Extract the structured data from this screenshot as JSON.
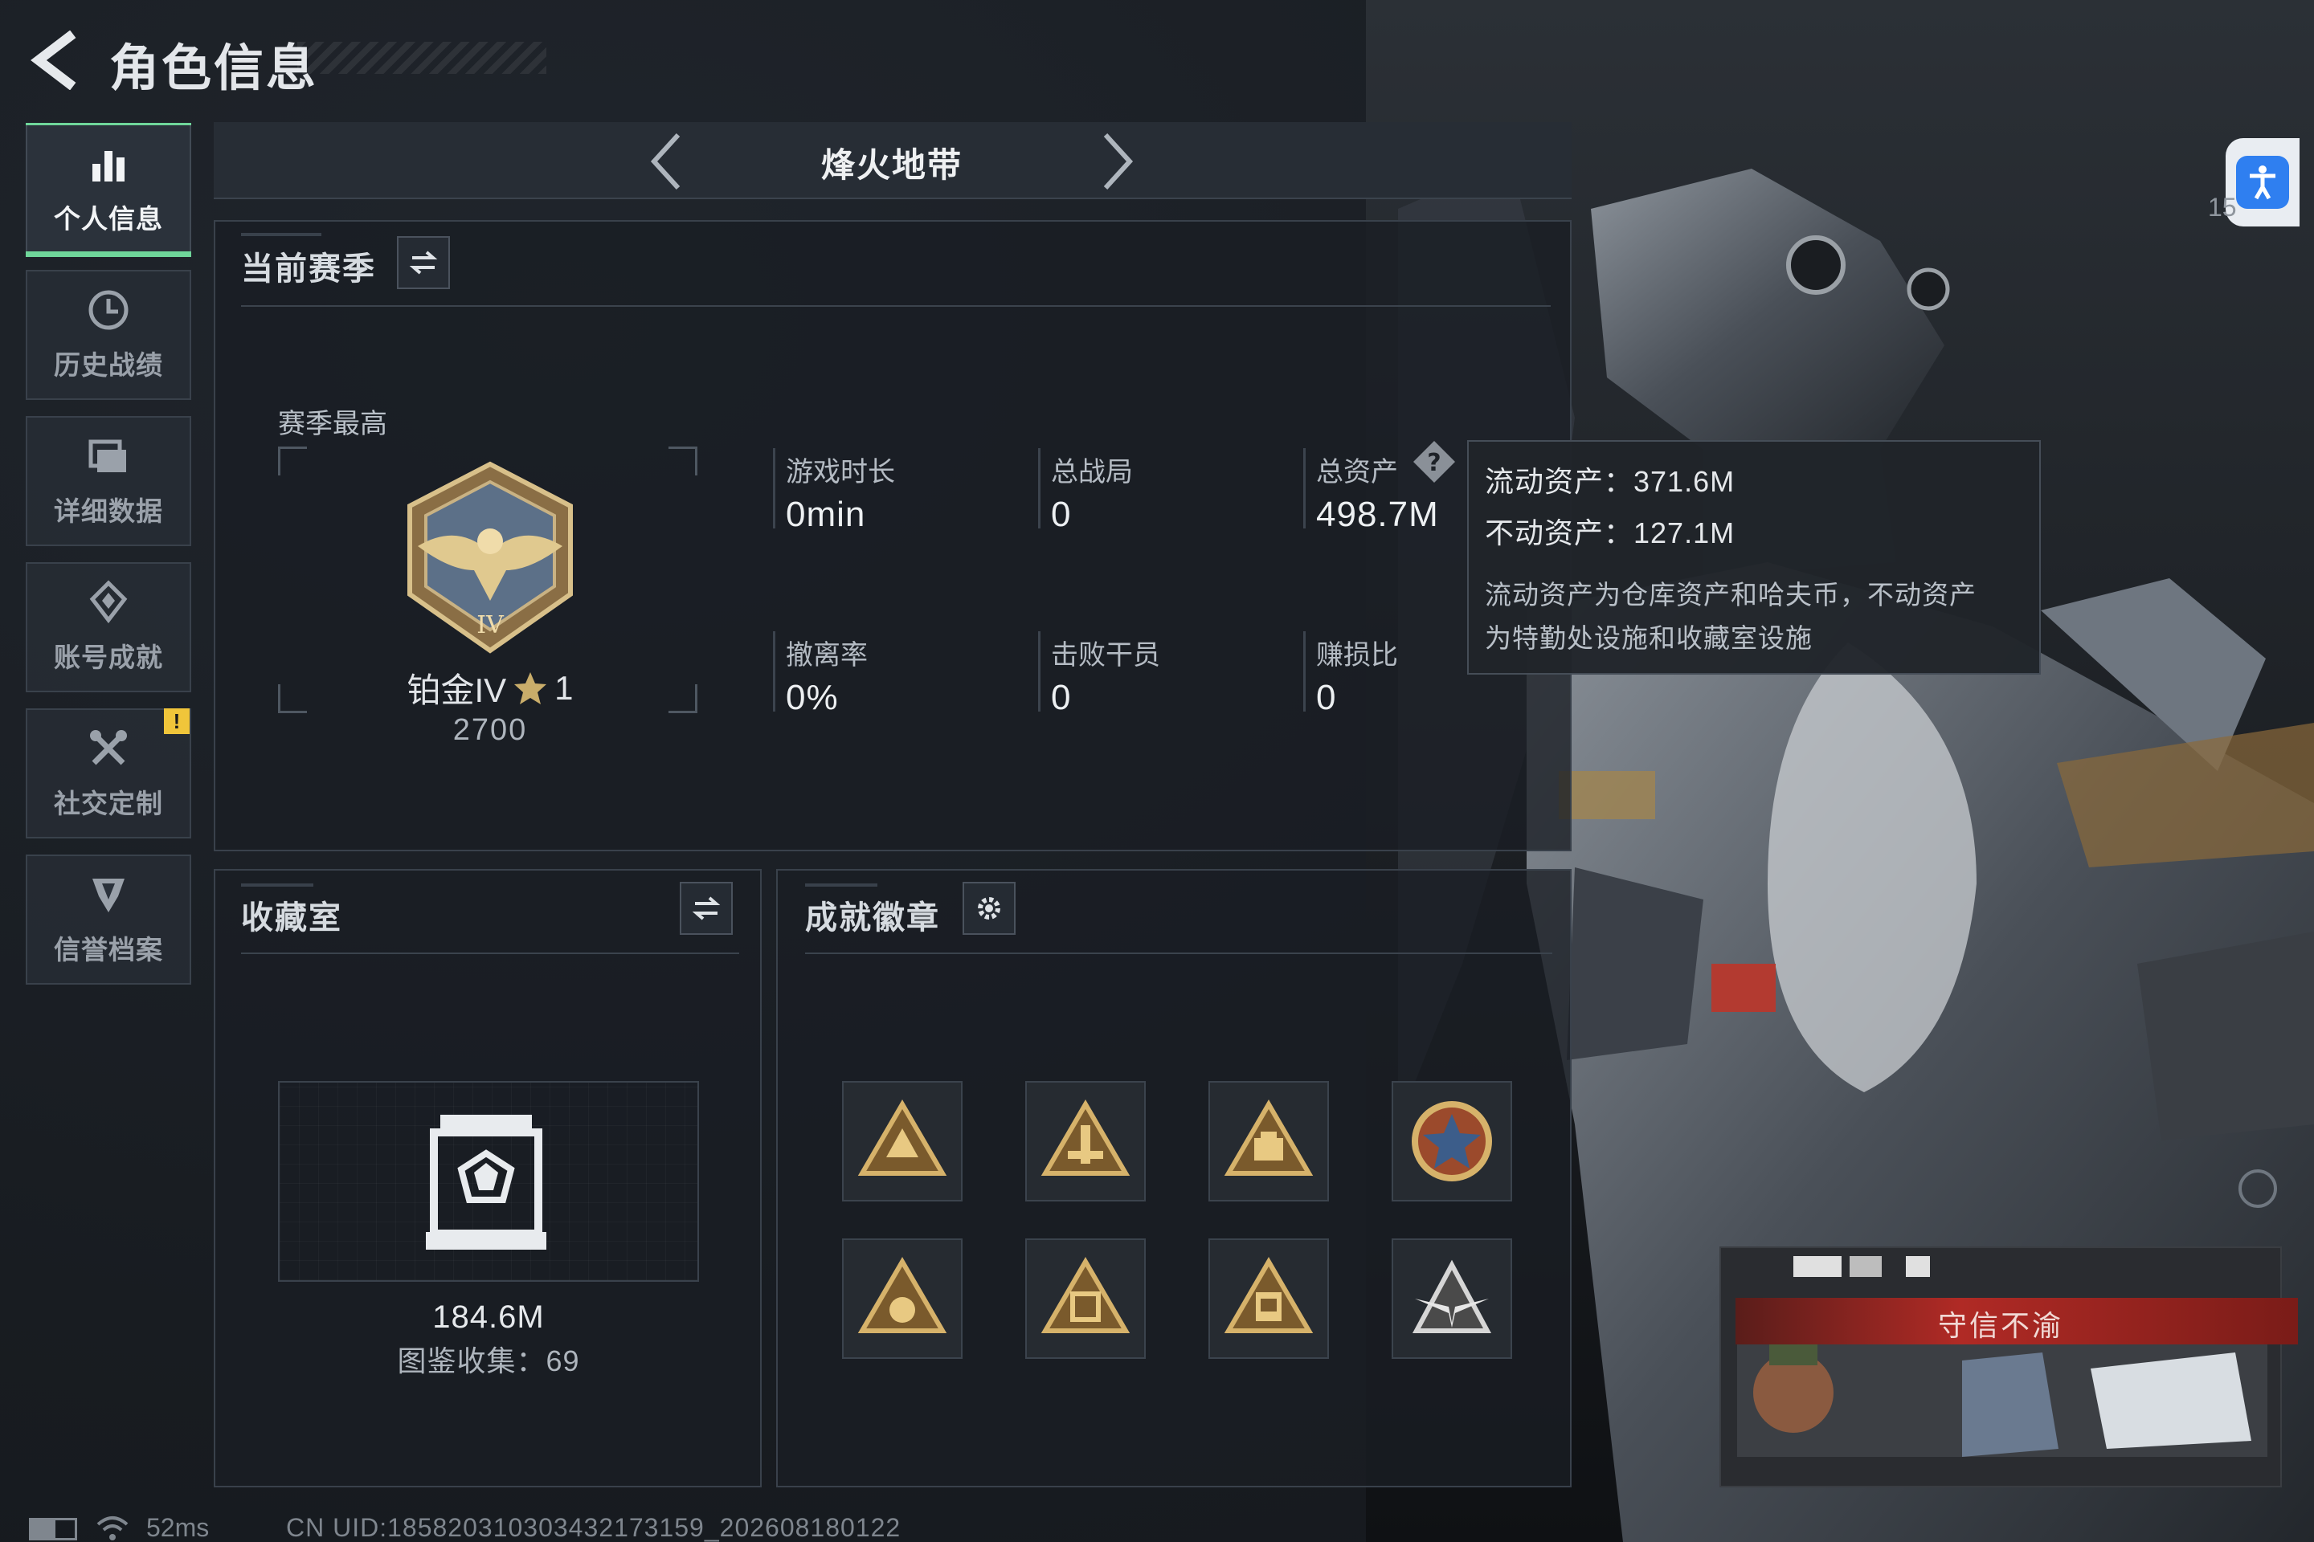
{
  "header": {
    "title": "角色信息"
  },
  "nav": [
    {
      "label": "个人信息",
      "icon": "bar-chart-icon",
      "active": true
    },
    {
      "label": "历史战绩",
      "icon": "history-icon",
      "active": false
    },
    {
      "label": "详细数据",
      "icon": "folder-icon",
      "active": false
    },
    {
      "label": "账号成就",
      "icon": "achievement-icon",
      "active": false
    },
    {
      "label": "社交定制",
      "icon": "tools-icon",
      "active": false,
      "alert": "!"
    },
    {
      "label": "信誉档案",
      "icon": "shield-icon",
      "active": false
    }
  ],
  "mode": {
    "name": "烽火地带"
  },
  "season": {
    "title": "当前赛季",
    "best_label": "赛季最高",
    "rank_name": "铂金IV",
    "rank_stars": "1",
    "rank_score": "2700",
    "stats": [
      {
        "label": "游戏时长",
        "value": "0min"
      },
      {
        "label": "总战局",
        "value": "0"
      },
      {
        "label": "总资产",
        "value": "498.7M"
      },
      {
        "label": "撤离率",
        "value": "0%"
      },
      {
        "label": "击败干员",
        "value": "0"
      },
      {
        "label": "赚损比",
        "value": "0"
      }
    ]
  },
  "tooltip": {
    "liquid": "流动资产：371.6M",
    "fixed": "不动资产：127.1M",
    "note_line1": "流动资产为仓库资产和哈夫币，不动资产",
    "note_line2": "为特勤处设施和收藏室设施"
  },
  "collection": {
    "title": "收藏室",
    "value": "184.6M",
    "count": "图鉴收集：69"
  },
  "badges": {
    "title": "成就徽章",
    "count": 8
  },
  "right": {
    "partial_number": "15",
    "honor_title": "守信不渝"
  },
  "footer": {
    "ping": "52ms",
    "uid": "CN UID:1858203103034321731​59_202608180122"
  },
  "colors": {
    "accent": "#6fd69a",
    "alert": "#f0c53a",
    "access": "#2f7ff0",
    "honor": "#b02a25"
  }
}
